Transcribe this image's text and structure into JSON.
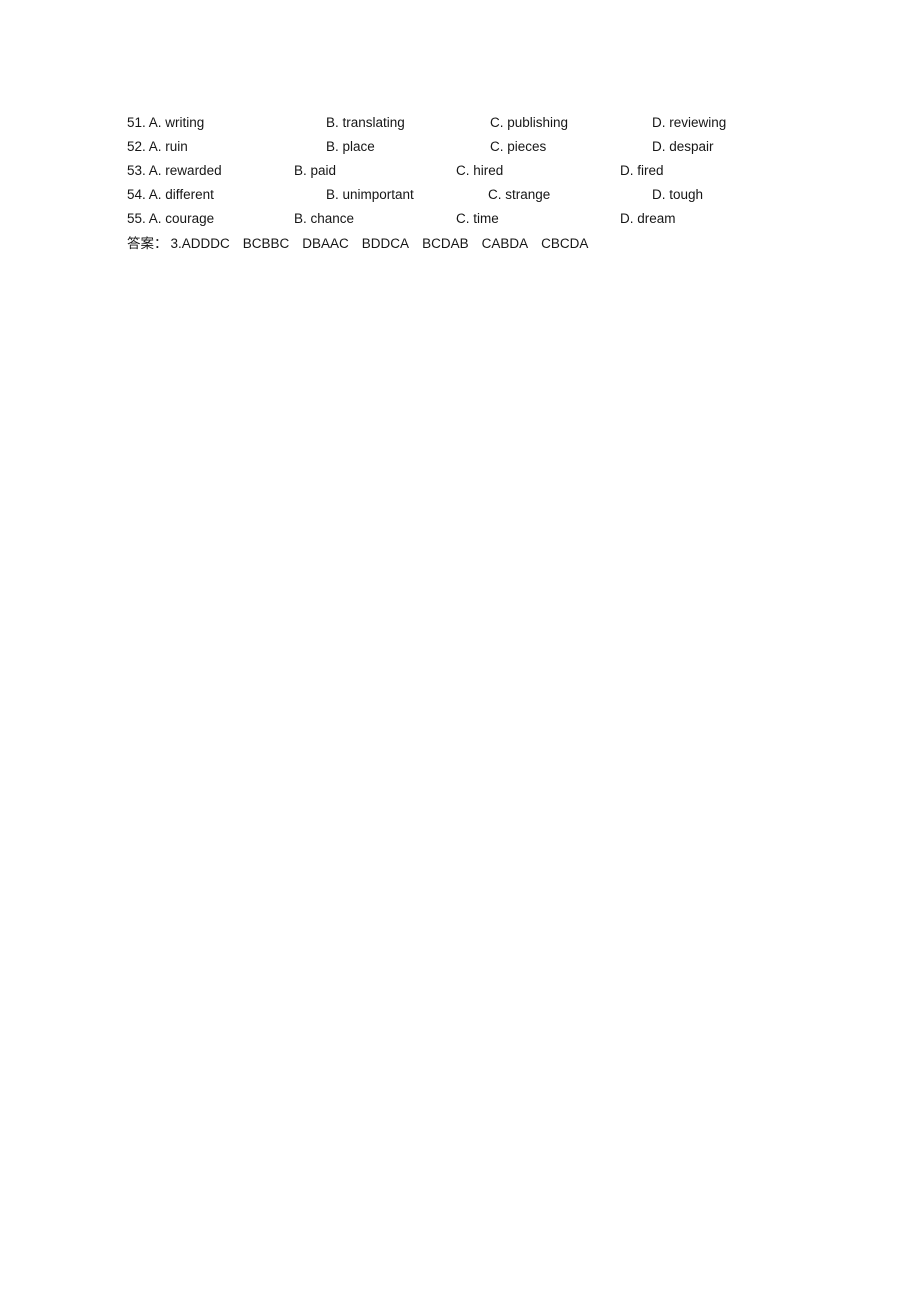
{
  "document": {
    "background_color": "#ffffff",
    "text_color": "#161616"
  },
  "questions": [
    {
      "number": "51.",
      "a": "A. writing",
      "b": "B. translating",
      "c": "C. publishing",
      "d": "D. reviewing"
    },
    {
      "number": "52.",
      "a": "A. ruin",
      "b": "B. place",
      "c": "C. pieces",
      "d": "D. despair"
    },
    {
      "number": "53.",
      "a": "A. rewarded",
      "b": "B. paid",
      "c": "C. hired",
      "d": "D. fired"
    },
    {
      "number": "54.",
      "a": "A. different",
      "b": "B. unimportant",
      "c": "C. strange",
      "d": "D. tough"
    },
    {
      "number": "55.",
      "a": "A. courage",
      "b": "B. chance",
      "c": "C. time",
      "d": "D. dream"
    }
  ],
  "answer_key": {
    "label": "答案：",
    "groups": [
      "3.ADDDC",
      "BCBBC",
      "DBAAC",
      "BDDCA",
      "BCDAB",
      "CABDA",
      "CBCDA"
    ]
  }
}
